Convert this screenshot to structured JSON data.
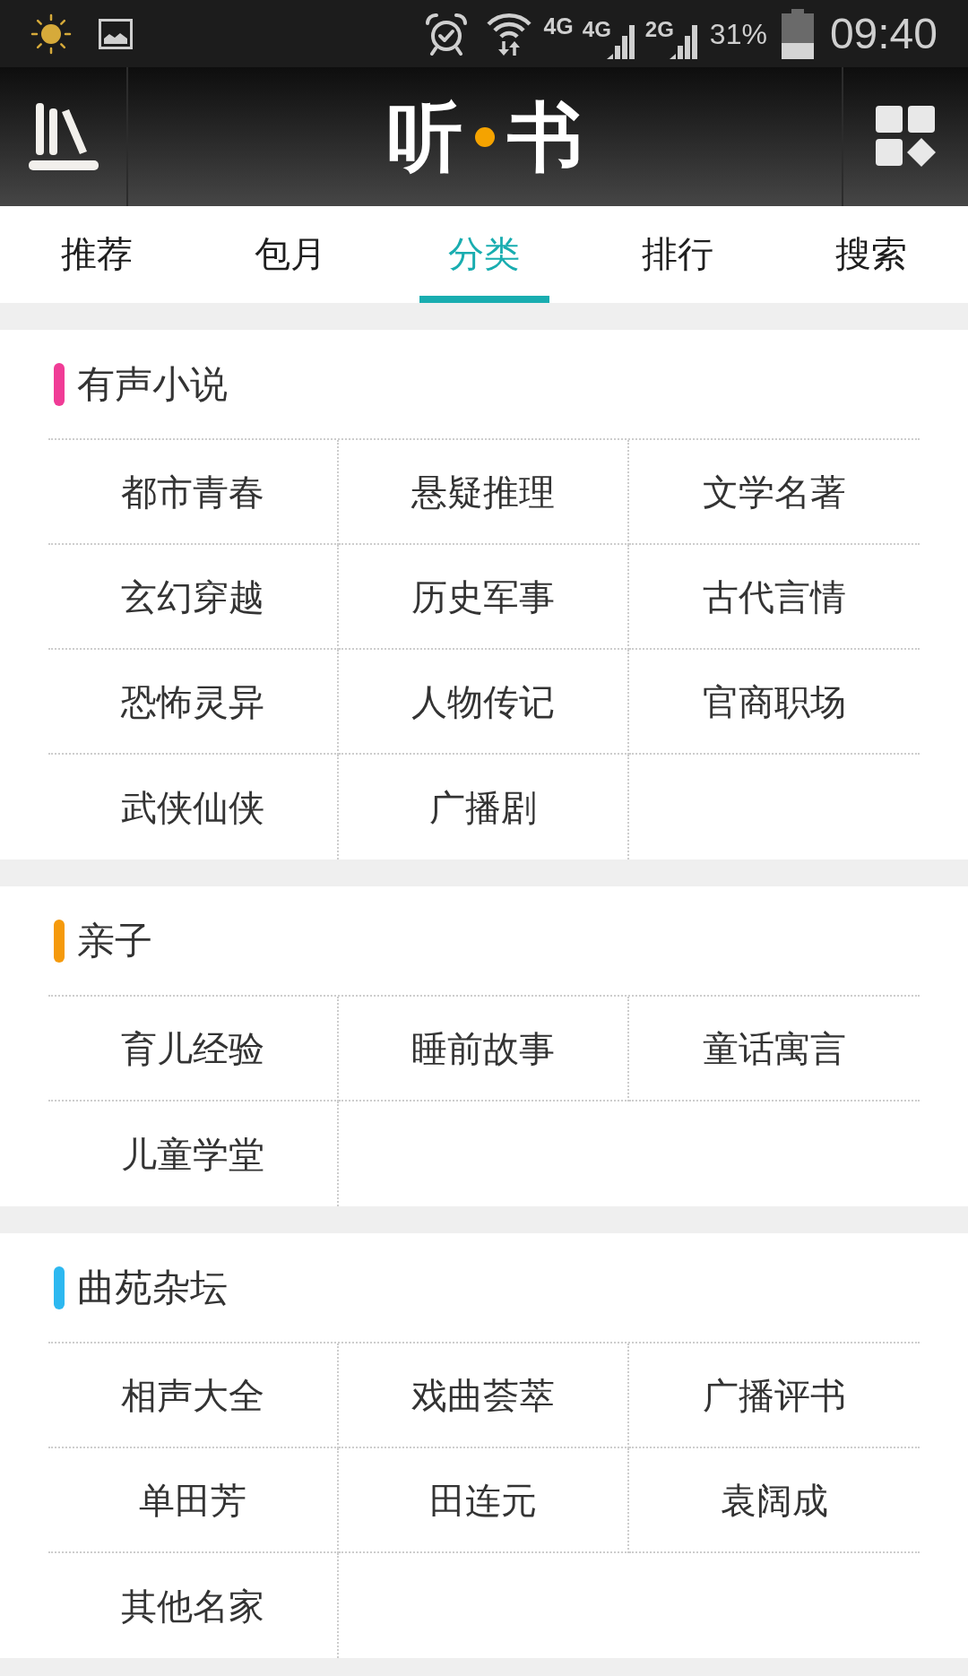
{
  "status_bar": {
    "network": "4G",
    "signals": [
      {
        "label": "4G"
      },
      {
        "label": "2G"
      }
    ],
    "battery_text": "31%",
    "time": "09:40"
  },
  "header": {
    "logo": [
      "听",
      "书"
    ]
  },
  "tabs": [
    {
      "label": "推荐",
      "selected": false
    },
    {
      "label": "包月",
      "selected": false
    },
    {
      "label": "分类",
      "selected": true
    },
    {
      "label": "排行",
      "selected": false
    },
    {
      "label": "搜索",
      "selected": false
    }
  ],
  "sections": [
    {
      "title": "有声小说",
      "color": "#f03c96",
      "items": [
        "都市青春",
        "悬疑推理",
        "文学名著",
        "玄幻穿越",
        "历史军事",
        "古代言情",
        "恐怖灵异",
        "人物传记",
        "官商职场",
        "武侠仙侠",
        "广播剧"
      ]
    },
    {
      "title": "亲子",
      "color": "#f59a0c",
      "items": [
        "育儿经验",
        "睡前故事",
        "童话寓言",
        "儿童学堂"
      ]
    },
    {
      "title": "曲苑杂坛",
      "color": "#2db8f0",
      "items": [
        "相声大全",
        "戏曲荟萃",
        "广播评书",
        "单田芳",
        "田连元",
        "袁阔成",
        "其他名家"
      ]
    }
  ]
}
